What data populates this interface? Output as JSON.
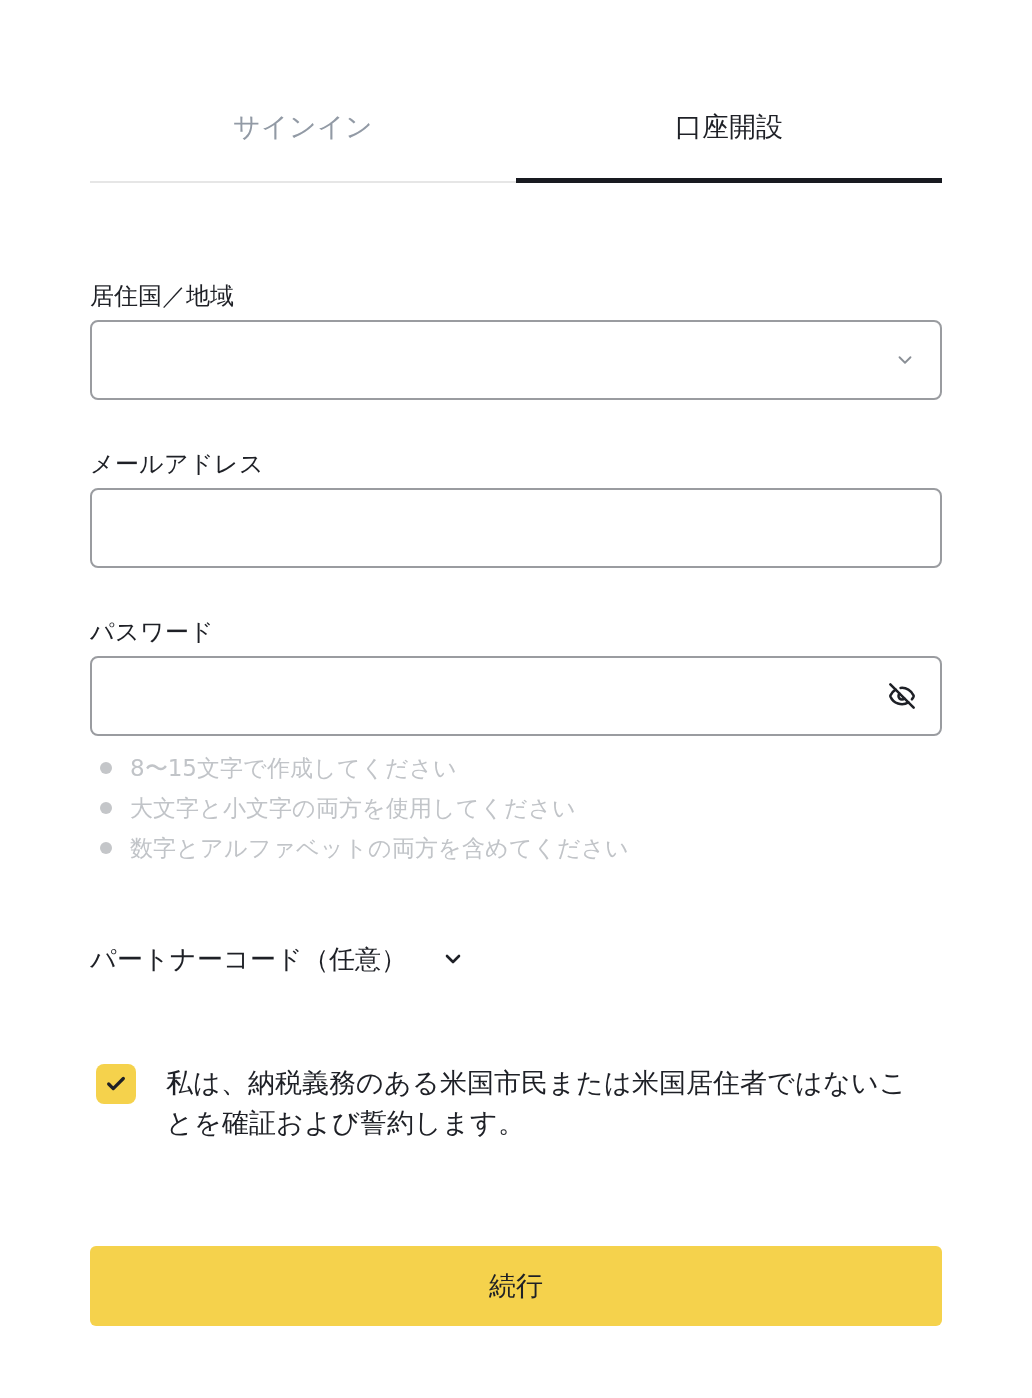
{
  "tabs": [
    {
      "label": "サインイン",
      "selected": false
    },
    {
      "label": "口座開設",
      "selected": true
    }
  ],
  "fields": [
    {
      "kind": "select",
      "label": "居住国／地域"
    },
    {
      "kind": "email",
      "label": "メールアドレス"
    },
    {
      "kind": "password",
      "label": "パスワード",
      "password_visible": false
    }
  ],
  "password_hints": [
    "8〜15文字で作成してください",
    "大文字と小文字の両方を使用してください",
    "数字とアルファベットの両方を含めてください"
  ],
  "partner_code": {
    "label": "パートナーコード（任意）",
    "expanded": false
  },
  "agreement": {
    "checked": true,
    "text": "私は、納税義務のある米国市民または米国居住者ではないことを確証および誓約します。"
  },
  "submit_button": {
    "label": "続行"
  }
}
